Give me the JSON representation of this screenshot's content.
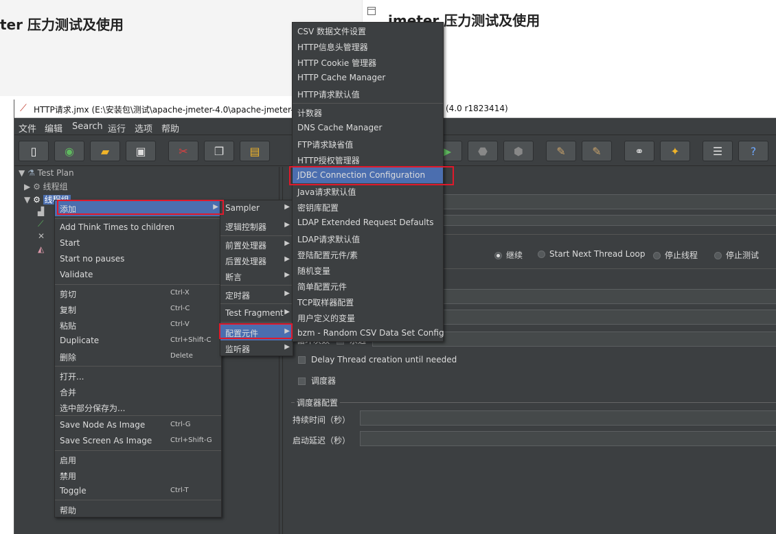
{
  "blog": {
    "title_left": "ter 压力测试及使用",
    "title_right": "jmeter 压力测试及使用"
  },
  "window": {
    "title_left": "HTTP请求.jmx (E:\\安装包\\测试\\apache-jmeter-4.0\\apache-jmeter-4",
    "title_right": "(4.0 r1823414)"
  },
  "menubar": [
    "文件",
    "编辑",
    "Search",
    "运行",
    "选项",
    "帮助"
  ],
  "tree": {
    "root": "Test Plan",
    "group1": "线程组",
    "group2": "线程组"
  },
  "context_menu": {
    "items": [
      {
        "label": "添加",
        "shortcut": ""
      },
      {
        "label": "Add Think Times to children",
        "shortcut": ""
      },
      {
        "label": "Start",
        "shortcut": ""
      },
      {
        "label": "Start no pauses",
        "shortcut": ""
      },
      {
        "label": "Validate",
        "shortcut": ""
      },
      {
        "label": "剪切",
        "shortcut": "Ctrl-X"
      },
      {
        "label": "复制",
        "shortcut": "Ctrl-C"
      },
      {
        "label": "粘贴",
        "shortcut": "Ctrl-V"
      },
      {
        "label": "Duplicate",
        "shortcut": "Ctrl+Shift-C"
      },
      {
        "label": "删除",
        "shortcut": "Delete"
      },
      {
        "label": "打开...",
        "shortcut": ""
      },
      {
        "label": "合并",
        "shortcut": ""
      },
      {
        "label": "选中部分保存为...",
        "shortcut": ""
      },
      {
        "label": "Save Node As Image",
        "shortcut": "Ctrl-G"
      },
      {
        "label": "Save Screen As Image",
        "shortcut": "Ctrl+Shift-G"
      },
      {
        "label": "启用",
        "shortcut": ""
      },
      {
        "label": "禁用",
        "shortcut": ""
      },
      {
        "label": "Toggle",
        "shortcut": "Ctrl-T"
      },
      {
        "label": "帮助",
        "shortcut": ""
      }
    ]
  },
  "add_submenu": {
    "items": [
      "Sampler",
      "逻辑控制器",
      "前置处理器",
      "后置处理器",
      "断言",
      "定时器",
      "Test Fragment",
      "配置元件",
      "监听器"
    ]
  },
  "config_submenu": {
    "items": [
      "CSV 数据文件设置",
      "HTTP信息头管理器",
      "HTTP Cookie 管理器",
      "HTTP Cache Manager",
      "HTTP请求默认值",
      "计数器",
      "DNS Cache Manager",
      "FTP请求缺省值",
      "HTTP授权管理器",
      "JDBC Connection Configuration",
      "Java请求默认值",
      "密钥库配置",
      "LDAP Extended Request Defaults",
      "LDAP请求默认值",
      "登陆配置元件/素",
      "随机变量",
      "简单配置元件",
      "TCP取样器配置",
      "用户定义的变量",
      "bzm - Random CSV Data Set Config"
    ]
  },
  "panel": {
    "radio_continue": "继续",
    "radio_next_loop": "Start Next Thread Loop",
    "radio_stop_thread": "停止线程",
    "radio_stop_test": "停止测试",
    "loop_label": "循环次数",
    "forever": "永远",
    "delay_thread": "Delay Thread creation until needed",
    "scheduler": "调度器",
    "scheduler_config": "调度器配置",
    "duration": "持续时间（秒）",
    "startup_delay": "启动延迟（秒）"
  },
  "colors": {
    "background": "#3c3f41",
    "highlight": "#4b6eaf",
    "annotation": "#e0192b"
  }
}
